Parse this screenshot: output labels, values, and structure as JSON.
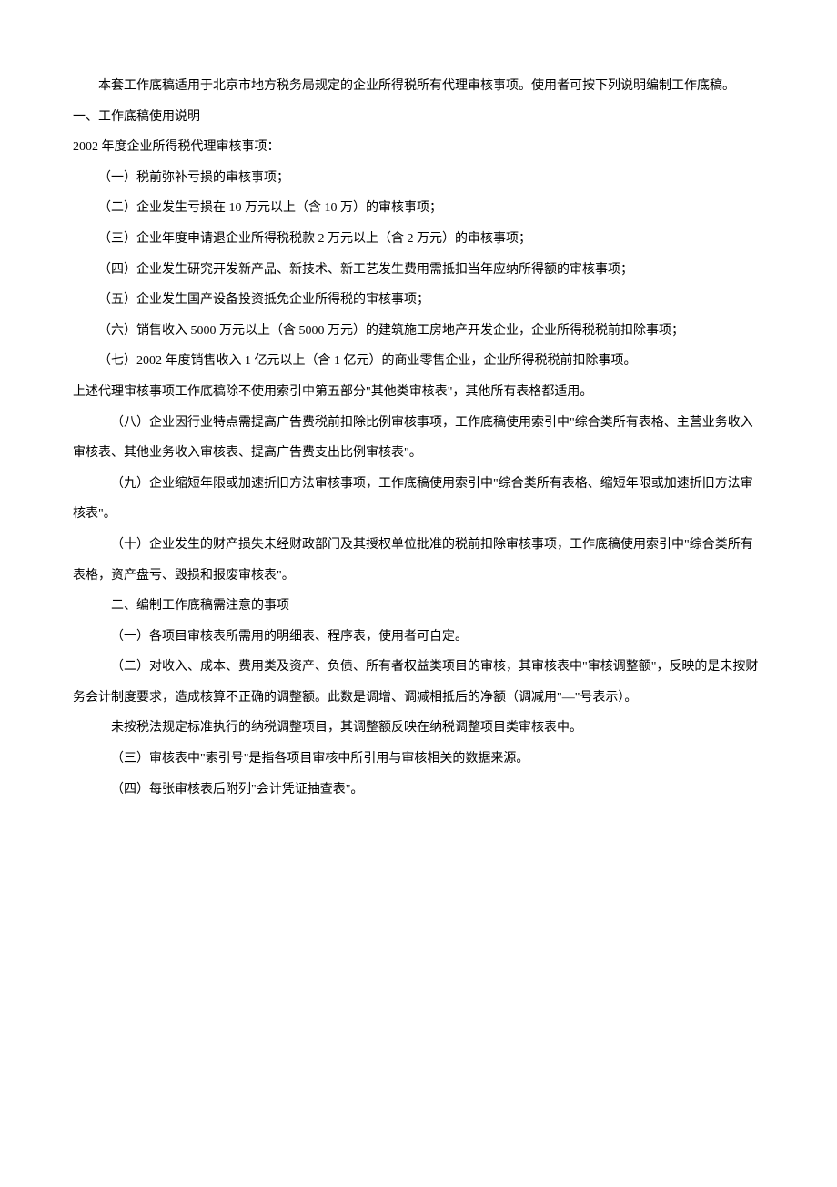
{
  "p1": "本套工作底稿适用于北京市地方税务局规定的企业所得税所有代理审核事项。使用者可按下列说明编制工作底稿。",
  "p2": "一、工作底稿使用说明",
  "p3": "2002 年度企业所得税代理审核事项：",
  "p4": "（一）税前弥补亏损的审核事项；",
  "p5": "（二）企业发生亏损在 10 万元以上（含 10 万）的审核事项；",
  "p6": "（三）企业年度申请退企业所得税税款 2 万元以上（含 2 万元）的审核事项；",
  "p7": "（四）企业发生研究开发新产品、新技术、新工艺发生费用需抵扣当年应纳所得额的审核事项；",
  "p8": "（五）企业发生国产设备投资抵免企业所得税的审核事项；",
  "p9": "（六）销售收入 5000 万元以上（含 5000 万元）的建筑施工房地产开发企业，企业所得税税前扣除事项；",
  "p10": "（七）2002 年度销售收入 1 亿元以上（含 1 亿元）的商业零售企业，企业所得税税前扣除事项。",
  "p11": "上述代理审核事项工作底稿除不使用索引中第五部分\"其他类审核表\"，其他所有表格都适用。",
  "p12": "（八）企业因行业特点需提高广告费税前扣除比例审核事项，工作底稿使用索引中\"综合类所有表格、主营业务收入审核表、其他业务收入审核表、提高广告费支出比例审核表\"。",
  "p13": "（九）企业缩短年限或加速折旧方法审核事项，工作底稿使用索引中\"综合类所有表格、缩短年限或加速折旧方法审核表\"。",
  "p14": "（十）企业发生的财产损失未经财政部门及其授权单位批准的税前扣除审核事项，工作底稿使用索引中\"综合类所有表格，资产盘亏、毁损和报废审核表\"。",
  "p15": "二、编制工作底稿需注意的事项",
  "p16": "（一）各项目审核表所需用的明细表、程序表，使用者可自定。",
  "p17": "（二）对收入、成本、费用类及资产、负债、所有者权益类项目的审核，其审核表中\"审核调整额\"，反映的是未按财务会计制度要求，造成核算不正确的调整额。此数是调增、调减相抵后的净额（调减用\"—\"号表示）。",
  "p18": "未按税法规定标准执行的纳税调整项目，其调整额反映在纳税调整项目类审核表中。",
  "p19": "（三）审核表中\"索引号\"是指各项目审核中所引用与审核相关的数据来源。",
  "p20": "（四）每张审核表后附列\"会计凭证抽查表\"。"
}
